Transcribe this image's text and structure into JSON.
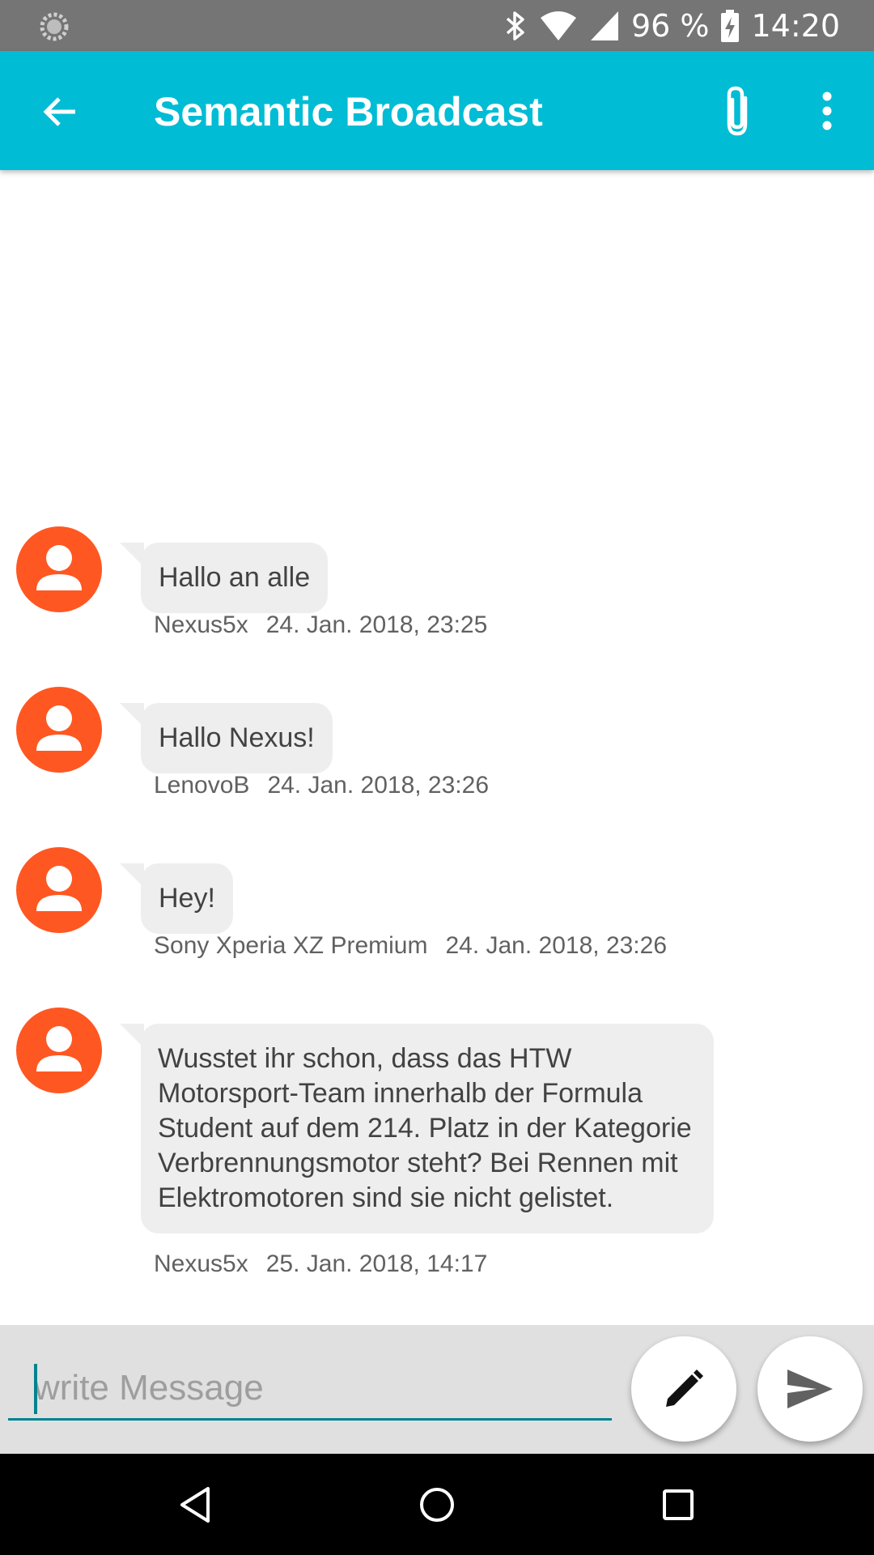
{
  "status_bar": {
    "battery": "96 %",
    "time": "14:20",
    "icons": [
      "sync-icon",
      "bluetooth-icon",
      "wifi-icon",
      "signal-icon",
      "battery-charging-icon"
    ]
  },
  "app_bar": {
    "title": "Semantic Broadcast",
    "background": "#00bcd4",
    "icons": [
      "back-arrow-icon",
      "paperclip-icon",
      "more-vert-icon"
    ]
  },
  "messages": [
    {
      "text": "Hallo an alle",
      "sender": "Nexus5x",
      "timestamp": "24. Jan. 2018, 23:25"
    },
    {
      "text": "Hallo Nexus!",
      "sender": "LenovoB",
      "timestamp": "24. Jan. 2018, 23:26"
    },
    {
      "text": "Hey!",
      "sender": "Sony Xperia XZ Premium",
      "timestamp": "24. Jan. 2018, 23:26"
    },
    {
      "text": "Wusstet ihr schon, dass das HTW Motorsport-Team innerhalb der Formula Student auf dem 214. Platz in der Kategorie Verbrennungsmotor steht? Bei Rennen mit Elektromotoren sind sie nicht gelistet.",
      "sender": "Nexus5x",
      "timestamp": "25. Jan. 2018, 14:17"
    }
  ],
  "input": {
    "placeholder": "write Message",
    "value": ""
  },
  "colors": {
    "avatar": "#ff5722",
    "bubble": "#eeeeee",
    "accent": "#00838f"
  },
  "nav_bar": {
    "icons": [
      "back-triangle-icon",
      "home-circle-icon",
      "recents-square-icon"
    ]
  }
}
